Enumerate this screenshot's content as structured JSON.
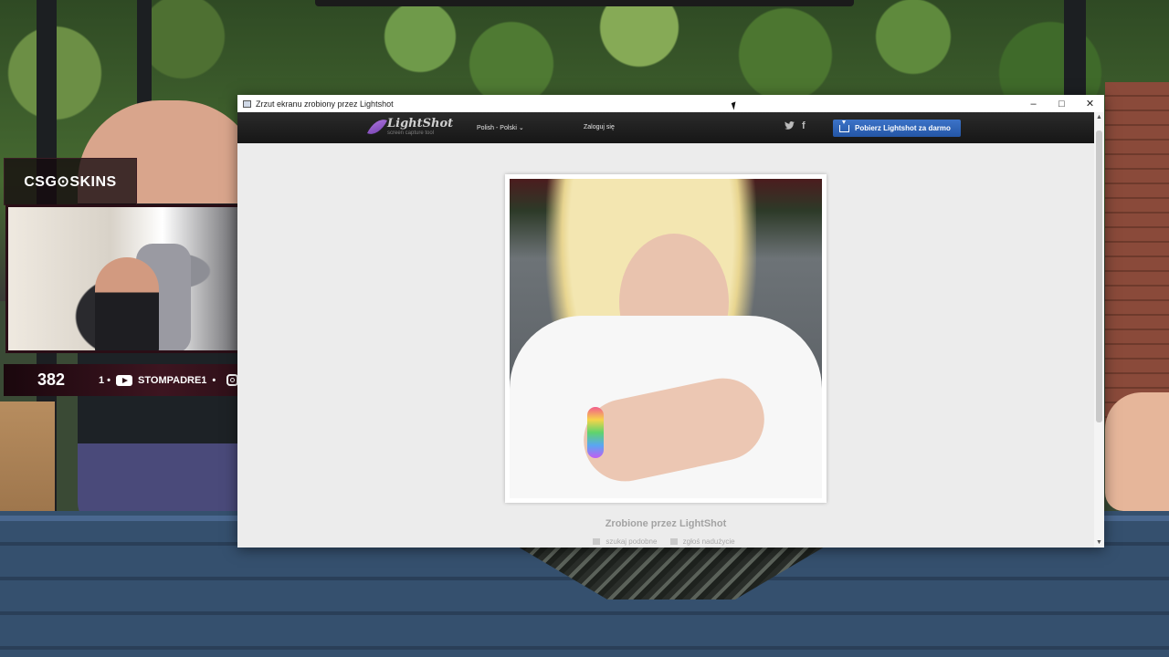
{
  "overlay": {
    "brand": "CSG⊙SKINS",
    "viewer_count": "382",
    "social_text": "STOMPADRE1",
    "social_prefix": "1 •",
    "social_sep": "•"
  },
  "window": {
    "title": "Zrzut ekranu zrobiony przez Lightshot",
    "minimize": "–",
    "maximize": "□",
    "close": "✕"
  },
  "lightshot": {
    "logo_name": "LightShot",
    "logo_tagline": "screen capture tool",
    "language": "Polish - Polski ⌄",
    "login": "Zaloguj się",
    "twitter": "🐦",
    "facebook": "f",
    "download": "Pobierz Lightshot za darmo",
    "caption": "Zrobione przez LightShot",
    "link_similar": "szukaj podobne",
    "link_report": "zgłoś nadużycie"
  },
  "icons": {
    "app": "window-app-icon",
    "logo": "feather-icon",
    "twitter": "twitter-icon",
    "facebook": "facebook-icon",
    "download": "download-icon"
  },
  "colors": {
    "download_button": "#2d5fb0",
    "header": "#1e1e1e",
    "page_bg": "#ececec",
    "overlay_accent": "#3d1520"
  }
}
